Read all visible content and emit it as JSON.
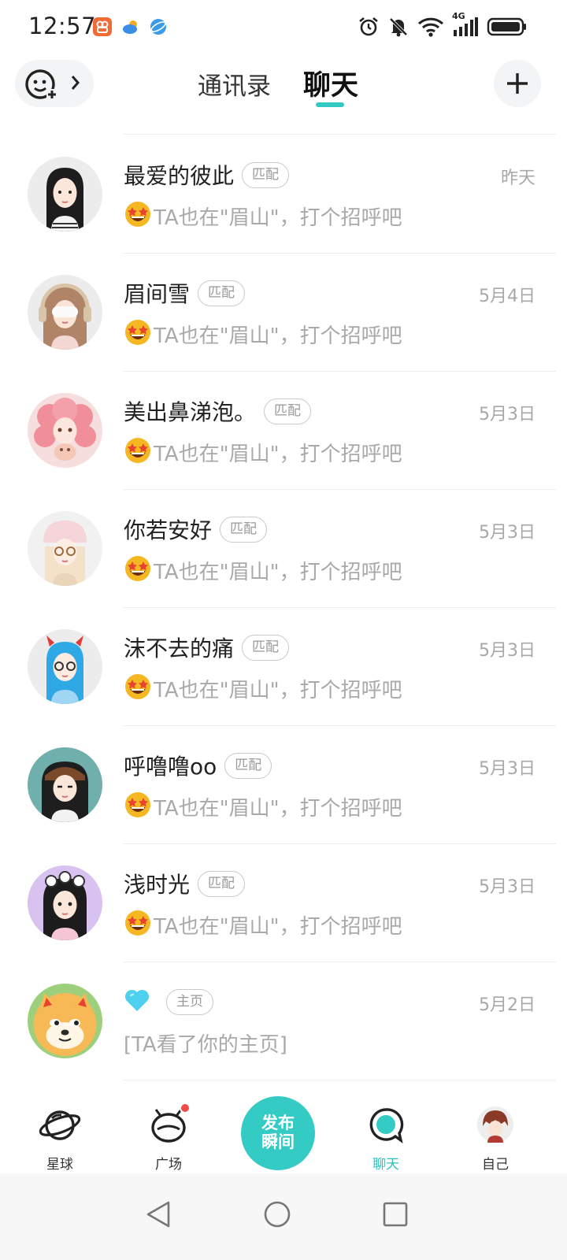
{
  "status_bar": {
    "time": "12:57",
    "network": "4G",
    "icons": [
      "app-icon-orange",
      "weather-icon",
      "browser-icon",
      "alarm-icon",
      "mute-icon",
      "wifi-icon",
      "signal-icon",
      "battery-icon"
    ]
  },
  "header": {
    "tabs": [
      {
        "label": "通讯录",
        "active": false
      },
      {
        "label": "聊天",
        "active": true
      }
    ],
    "accent_color": "#34c9c3"
  },
  "chats": [
    {
      "name": "最爱的彼此",
      "tag": "匹配",
      "time": "昨天",
      "emoji": "star-struck-emoji",
      "message": "TA也在\"眉山\"，打个招呼吧"
    },
    {
      "name": "眉间雪",
      "tag": "匹配",
      "time": "5月4日",
      "emoji": "star-struck-emoji",
      "message": "TA也在\"眉山\"，打个招呼吧"
    },
    {
      "name": "美出鼻涕泡。",
      "tag": "匹配",
      "time": "5月3日",
      "emoji": "star-struck-emoji",
      "message": "TA也在\"眉山\"，打个招呼吧"
    },
    {
      "name": "你若安好",
      "tag": "匹配",
      "time": "5月3日",
      "emoji": "star-struck-emoji",
      "message": "TA也在\"眉山\"，打个招呼吧"
    },
    {
      "name": "沫不去的痛",
      "tag": "匹配",
      "time": "5月3日",
      "emoji": "star-struck-emoji",
      "message": "TA也在\"眉山\"，打个招呼吧"
    },
    {
      "name": "呼噜噜oo",
      "tag": "匹配",
      "time": "5月3日",
      "emoji": "star-struck-emoji",
      "message": "TA也在\"眉山\"，打个招呼吧"
    },
    {
      "name": "浅时光",
      "tag": "匹配",
      "time": "5月3日",
      "emoji": "star-struck-emoji",
      "message": "TA也在\"眉山\"，打个招呼吧"
    },
    {
      "name": "",
      "name_icon": "blue-heart-icon",
      "tag": "主页",
      "time": "5月2日",
      "message": "[TA看了你的主页]"
    }
  ],
  "bottom_nav": {
    "items": [
      {
        "label": "星球",
        "icon": "planet-icon",
        "active": false
      },
      {
        "label": "广场",
        "icon": "square-icon",
        "active": false,
        "has_badge": true
      },
      {
        "label": "聊天",
        "icon": "chat-bubble-icon",
        "active": true
      },
      {
        "label": "自己",
        "icon": "self-avatar",
        "active": false
      }
    ],
    "publish_label_line1": "发布",
    "publish_label_line2": "瞬间"
  }
}
